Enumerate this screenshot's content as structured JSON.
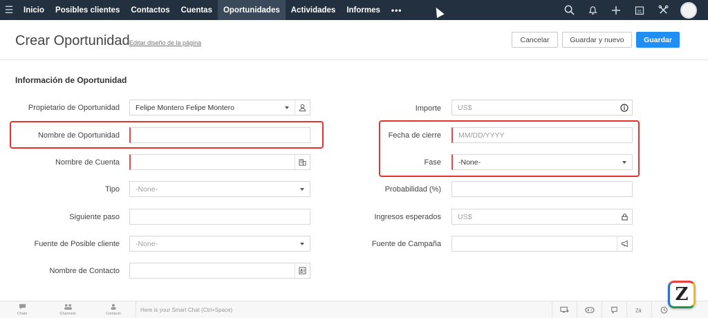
{
  "nav": {
    "menu_icon": "hamburger-icon",
    "items": [
      {
        "label": "Inicio",
        "active": false
      },
      {
        "label": "Posibles clientes",
        "active": false
      },
      {
        "label": "Contactos",
        "active": false
      },
      {
        "label": "Cuentas",
        "active": false
      },
      {
        "label": "Oportunidades",
        "active": true
      },
      {
        "label": "Actividades",
        "active": false
      },
      {
        "label": "Informes",
        "active": false
      }
    ],
    "more": "•••",
    "icons": [
      "search-icon",
      "bell-icon",
      "plus-icon",
      "calendar-icon",
      "tools-icon",
      "avatar"
    ]
  },
  "header": {
    "title": "Crear Oportunidad",
    "edit_layout": "Editar diseño de la página",
    "cancel": "Cancelar",
    "save_new": "Guardar y nuevo",
    "save": "Guardar"
  },
  "section": {
    "title": "Información de Oportunidad"
  },
  "left_fields": [
    {
      "label": "Propietario de Oportunidad",
      "value": "Felipe Montero Felipe Montero",
      "placeholder": "",
      "type": "lookup-select",
      "icon": "user-icon",
      "required": false
    },
    {
      "label": "Nombre de Oportunidad",
      "value": "",
      "placeholder": "",
      "type": "text",
      "icon": "",
      "required": true
    },
    {
      "label": "Nombre de Cuenta",
      "value": "",
      "placeholder": "",
      "type": "lookup",
      "icon": "building-icon",
      "required": true
    },
    {
      "label": "Tipo",
      "value": "-None-",
      "placeholder": "",
      "type": "select",
      "icon": "",
      "required": false
    },
    {
      "label": "Siguiente paso",
      "value": "",
      "placeholder": "",
      "type": "text",
      "icon": "",
      "required": false
    },
    {
      "label": "Fuente de Posible cliente",
      "value": "-None-",
      "placeholder": "",
      "type": "select",
      "icon": "",
      "required": false
    },
    {
      "label": "Nombre de Contacto",
      "value": "",
      "placeholder": "",
      "type": "lookup",
      "icon": "contact-card-icon",
      "required": false
    }
  ],
  "right_fields": [
    {
      "label": "Importe",
      "value": "",
      "placeholder": "US$",
      "type": "currency",
      "icon": "info-icon",
      "required": false
    },
    {
      "label": "Fecha de cierre",
      "value": "",
      "placeholder": "MM/DD/YYYY",
      "type": "date",
      "icon": "",
      "required": true
    },
    {
      "label": "Fase",
      "value": "-None-",
      "placeholder": "",
      "type": "select",
      "icon": "",
      "required": true
    },
    {
      "label": "Probabilidad (%)",
      "value": "",
      "placeholder": "",
      "type": "text",
      "icon": "",
      "required": false
    },
    {
      "label": "Ingresos esperados",
      "value": "",
      "placeholder": "US$",
      "type": "currency-locked",
      "icon": "lock-icon",
      "required": false
    },
    {
      "label": "Fuente de Campaña",
      "value": "",
      "placeholder": "",
      "type": "lookup",
      "icon": "megaphone-icon",
      "required": false
    }
  ],
  "bottom": {
    "chats": "Chats",
    "channels": "Channels",
    "contacts": "Contacts",
    "smart_chat": "Here is your Smart Chat (Ctrl+Space)",
    "right_icons": [
      "screen-icon",
      "gamepad-icon",
      "chat-icon",
      "bookmark-icon",
      "translate-icon",
      "clock-icon"
    ]
  },
  "logo": {
    "letter": "Z"
  },
  "colors": {
    "nav_bg": "#22303f",
    "primary": "#1f8ff5",
    "highlight": "#e5322d",
    "required": "#e24a4a"
  }
}
